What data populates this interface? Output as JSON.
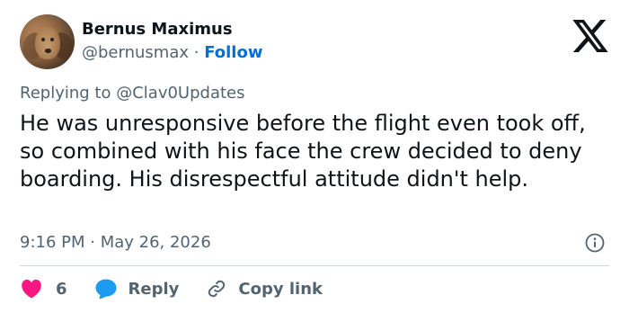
{
  "author": {
    "name": "Bernus Maximus",
    "handle": "@bernusmax",
    "separator": "·",
    "follow_label": "Follow",
    "avatar": "dog-avatar"
  },
  "brand": {
    "logo": "x-logo-icon"
  },
  "reply_context": {
    "prefix": "Replying to",
    "mention": "@Clav0Updates"
  },
  "tweet": {
    "text": "He was unresponsive before the flight even took off, so combined with his face the crew decided to deny boarding. His disrespectful attitude didn't help.",
    "timestamp": "9:16 PM · May 26, 2026",
    "info_icon": "info-icon"
  },
  "actions": {
    "like_count": "6",
    "reply_label": "Reply",
    "copy_link_label": "Copy link"
  },
  "colors": {
    "text": "#0f1419",
    "secondary": "#536471",
    "link": "#006fd6",
    "like": "#f91880",
    "reply": "#1d9bf0",
    "divider": "#cfd9de"
  }
}
